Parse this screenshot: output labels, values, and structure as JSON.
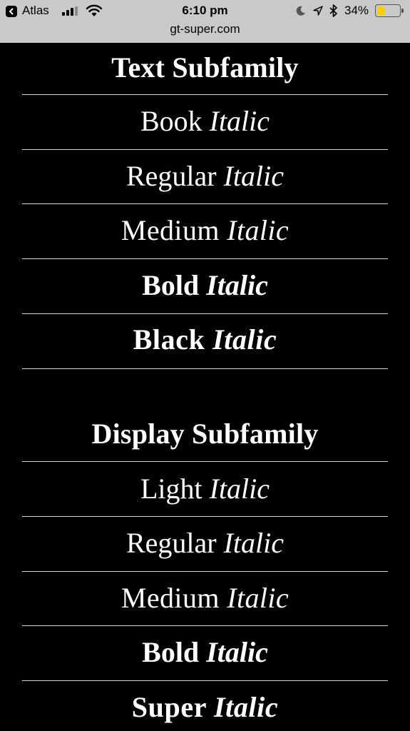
{
  "status_bar": {
    "back_app": "Atlas",
    "time": "6:10 pm",
    "url": "gt-super.com",
    "battery_percent": "34%",
    "battery_level": 0.34,
    "battery_color": "#ffcc00"
  },
  "text_subfamily": {
    "heading": "Text Subfamily",
    "styles": [
      {
        "name": "Book",
        "suffix": "Italic"
      },
      {
        "name": "Regular",
        "suffix": "Italic"
      },
      {
        "name": "Medium",
        "suffix": "Italic"
      },
      {
        "name": "Bold",
        "suffix": "Italic"
      },
      {
        "name": "Black",
        "suffix": "Italic"
      }
    ]
  },
  "display_subfamily": {
    "heading": "Display Subfamily",
    "styles": [
      {
        "name": "Light",
        "suffix": "Italic"
      },
      {
        "name": "Regular",
        "suffix": "Italic"
      },
      {
        "name": "Medium",
        "suffix": "Italic"
      },
      {
        "name": "Bold",
        "suffix": "Italic"
      },
      {
        "name": "Super",
        "suffix": "Italic"
      }
    ]
  }
}
